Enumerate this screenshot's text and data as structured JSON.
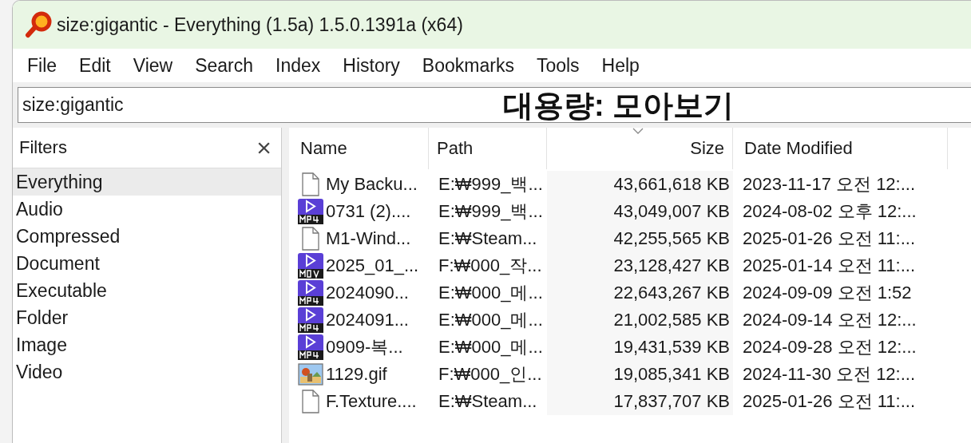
{
  "window": {
    "title": "size:gigantic - Everything (1.5a) 1.5.0.1391a (x64)"
  },
  "menu": [
    "File",
    "Edit",
    "View",
    "Search",
    "Index",
    "History",
    "Bookmarks",
    "Tools",
    "Help"
  ],
  "search": {
    "value": "size:gigantic"
  },
  "caption": "대용량: 모아보기",
  "filters": {
    "title": "Filters",
    "close": "×",
    "items": [
      {
        "label": "Everything",
        "selected": true
      },
      {
        "label": "Audio",
        "selected": false
      },
      {
        "label": "Compressed",
        "selected": false
      },
      {
        "label": "Document",
        "selected": false
      },
      {
        "label": "Executable",
        "selected": false
      },
      {
        "label": "Folder",
        "selected": false
      },
      {
        "label": "Image",
        "selected": false
      },
      {
        "label": "Video",
        "selected": false
      }
    ]
  },
  "table": {
    "columns": [
      {
        "label": "Name",
        "sorted": false
      },
      {
        "label": "Path",
        "sorted": false
      },
      {
        "label": "Size",
        "sorted": true
      },
      {
        "label": "Date Modified",
        "sorted": false
      }
    ],
    "rows": [
      {
        "kind": "file",
        "name": "My Backu...",
        "path": "E:₩999_백...",
        "size": "43,661,618 KB",
        "date": "2023-11-17 오전 12:..."
      },
      {
        "kind": "mp4",
        "name": "0731 (2)....",
        "path": "E:₩999_백...",
        "size": "43,049,007 KB",
        "date": "2024-08-02 오후 12:..."
      },
      {
        "kind": "file",
        "name": "M1-Wind...",
        "path": "E:₩Steam...",
        "size": "42,255,565 KB",
        "date": "2025-01-26 오전 11:..."
      },
      {
        "kind": "mov",
        "name": "2025_01_...",
        "path": "F:₩000_작...",
        "size": "23,128,427 KB",
        "date": "2025-01-14 오전 11:..."
      },
      {
        "kind": "mp4",
        "name": "2024090...",
        "path": "E:₩000_메...",
        "size": "22,643,267 KB",
        "date": "2024-09-09 오전 1:52"
      },
      {
        "kind": "mp4",
        "name": "2024091...",
        "path": "E:₩000_메...",
        "size": "21,002,585 KB",
        "date": "2024-09-14 오전 12:..."
      },
      {
        "kind": "mp4",
        "name": "0909-복...",
        "path": "E:₩000_메...",
        "size": "19,431,539 KB",
        "date": "2024-09-28 오전 12:..."
      },
      {
        "kind": "image",
        "name": "1129.gif",
        "path": "F:₩000_인...",
        "size": "19,085,341 KB",
        "date": "2024-11-30 오전 12:..."
      },
      {
        "kind": "file",
        "name": "F.Texture....",
        "path": "E:₩Steam...",
        "size": "17,837,707 KB",
        "date": "2025-01-26 오전 11:..."
      }
    ]
  }
}
